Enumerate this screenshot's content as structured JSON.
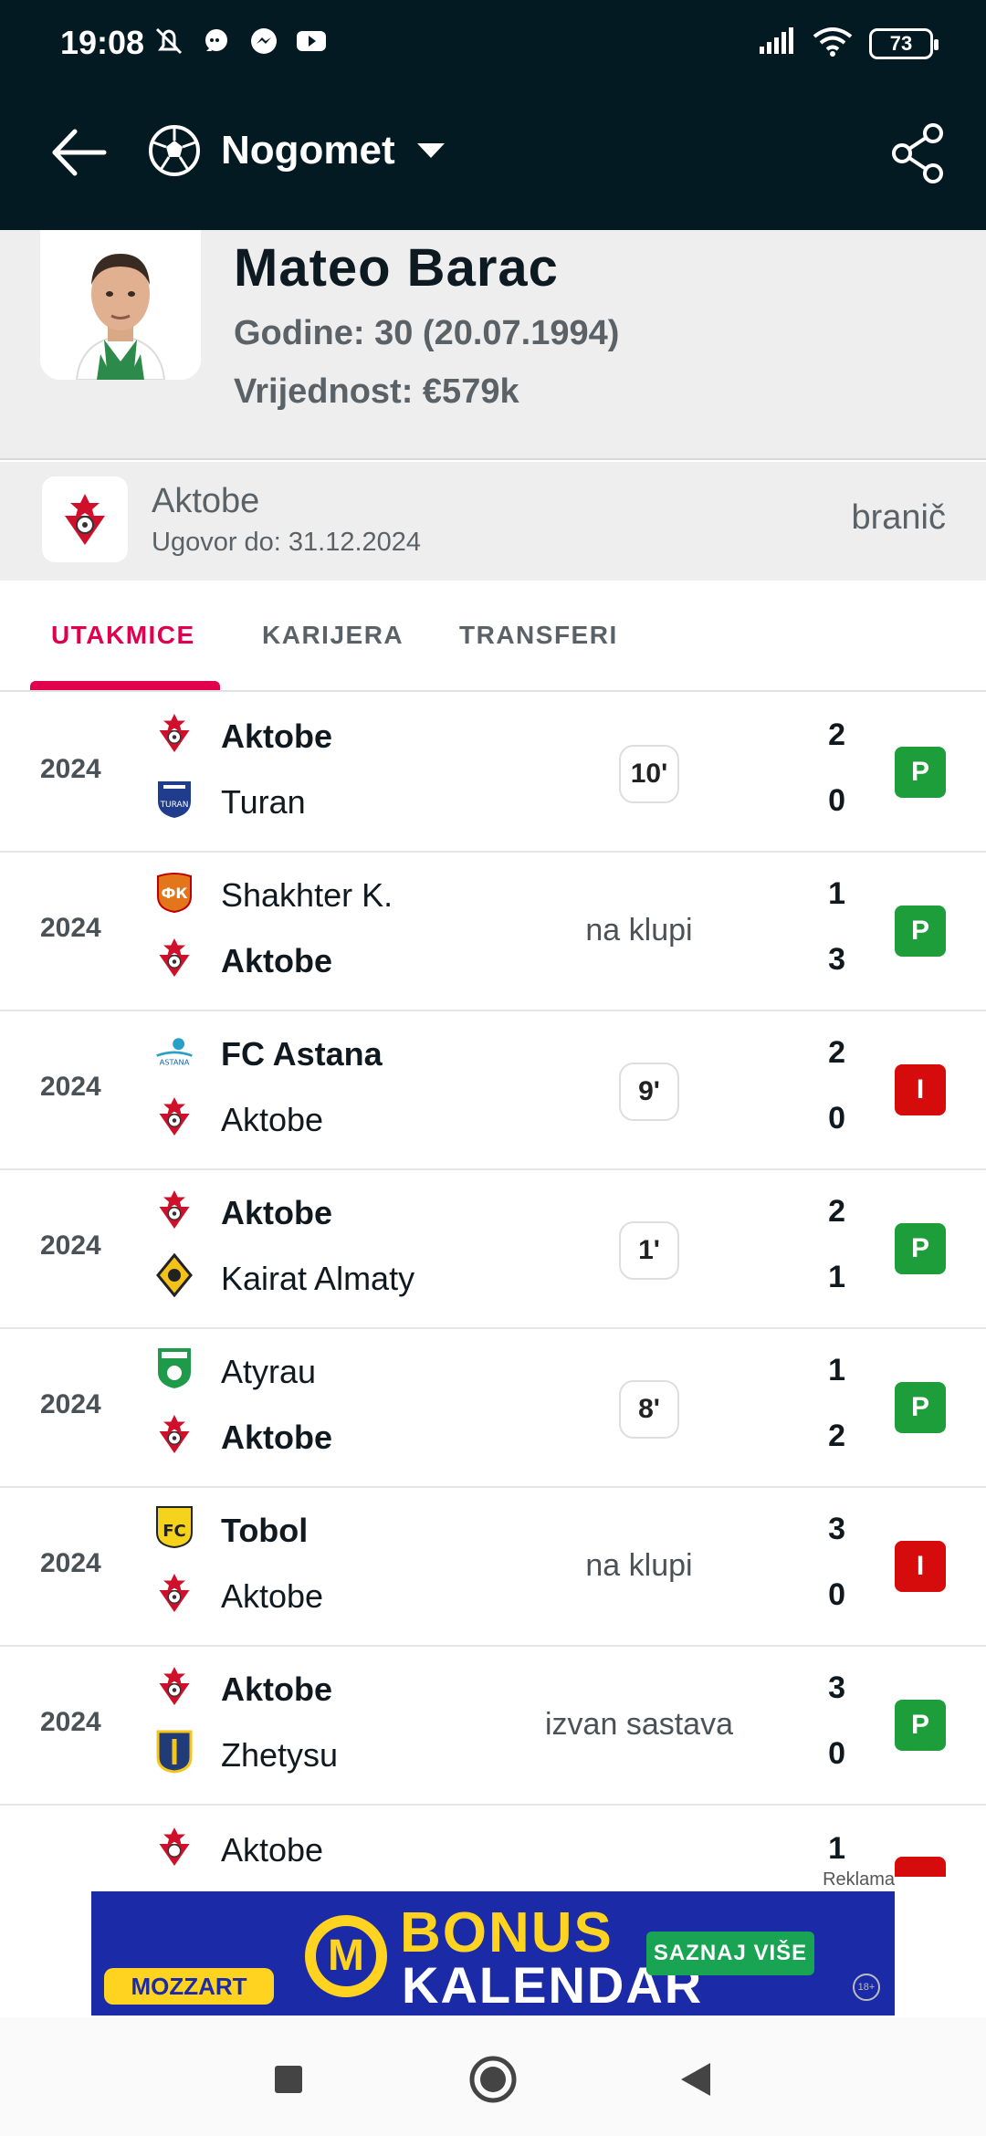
{
  "status_bar": {
    "time": "19:08",
    "battery": "73",
    "icons": [
      "mute-icon",
      "chat-bubble-icon",
      "messenger-icon",
      "youtube-icon",
      "signal-icon",
      "wifi-icon",
      "battery-icon"
    ]
  },
  "app_bar": {
    "sport_label": "Nogomet",
    "icons": [
      "back-arrow-icon",
      "soccer-ball-icon",
      "dropdown-caret-icon",
      "share-icon"
    ]
  },
  "player": {
    "name": "Mateo Barac",
    "age_line": "Godine: 30 (20.07.1994)",
    "value_line": "Vrijednost: €579k"
  },
  "club": {
    "name": "Aktobe",
    "contract": "Ugovor do: 31.12.2024",
    "position": "branič"
  },
  "tabs": [
    {
      "label": "UTAKMICE",
      "active": true
    },
    {
      "label": "KARIJERA",
      "active": false
    },
    {
      "label": "TRANSFERI",
      "active": false
    }
  ],
  "matches": [
    {
      "year": "2024",
      "team1": "Aktobe",
      "team2": "Turan",
      "bold": 1,
      "score1": "2",
      "score2": "0",
      "minutes": "10'",
      "status": "",
      "result": "P",
      "result_type": "win"
    },
    {
      "year": "2024",
      "team1": "Shakhter K.",
      "team2": "Aktobe",
      "bold": 2,
      "score1": "1",
      "score2": "3",
      "minutes": "",
      "status": "na klupi",
      "result": "P",
      "result_type": "win"
    },
    {
      "year": "2024",
      "team1": "FC Astana",
      "team2": "Aktobe",
      "bold": 1,
      "score1": "2",
      "score2": "0",
      "minutes": "9'",
      "status": "",
      "result": "I",
      "result_type": "loss"
    },
    {
      "year": "2024",
      "team1": "Aktobe",
      "team2": "Kairat Almaty",
      "bold": 1,
      "score1": "2",
      "score2": "1",
      "minutes": "1'",
      "status": "",
      "result": "P",
      "result_type": "win"
    },
    {
      "year": "2024",
      "team1": "Atyrau",
      "team2": "Aktobe",
      "bold": 2,
      "score1": "1",
      "score2": "2",
      "minutes": "8'",
      "status": "",
      "result": "P",
      "result_type": "win"
    },
    {
      "year": "2024",
      "team1": "Tobol",
      "team2": "Aktobe",
      "bold": 1,
      "score1": "3",
      "score2": "0",
      "minutes": "",
      "status": "na klupi",
      "result": "I",
      "result_type": "loss"
    },
    {
      "year": "2024",
      "team1": "Aktobe",
      "team2": "Zhetysu",
      "bold": 1,
      "score1": "3",
      "score2": "0",
      "minutes": "",
      "status": "izvan sastava",
      "result": "P",
      "result_type": "win"
    }
  ],
  "partial_match": {
    "team1": "Aktobe",
    "score1": "1"
  },
  "ad": {
    "label": "Reklama",
    "brand": "MOZZART",
    "title_line1": "BONUS",
    "title_line2": "KALENDAR",
    "cta": "SAZNAJ VIŠE",
    "age": "18+"
  },
  "colors": {
    "header_bg": "#031a22",
    "accent": "#e0004d",
    "win": "#1d9e3a",
    "loss": "#d60b0b"
  }
}
